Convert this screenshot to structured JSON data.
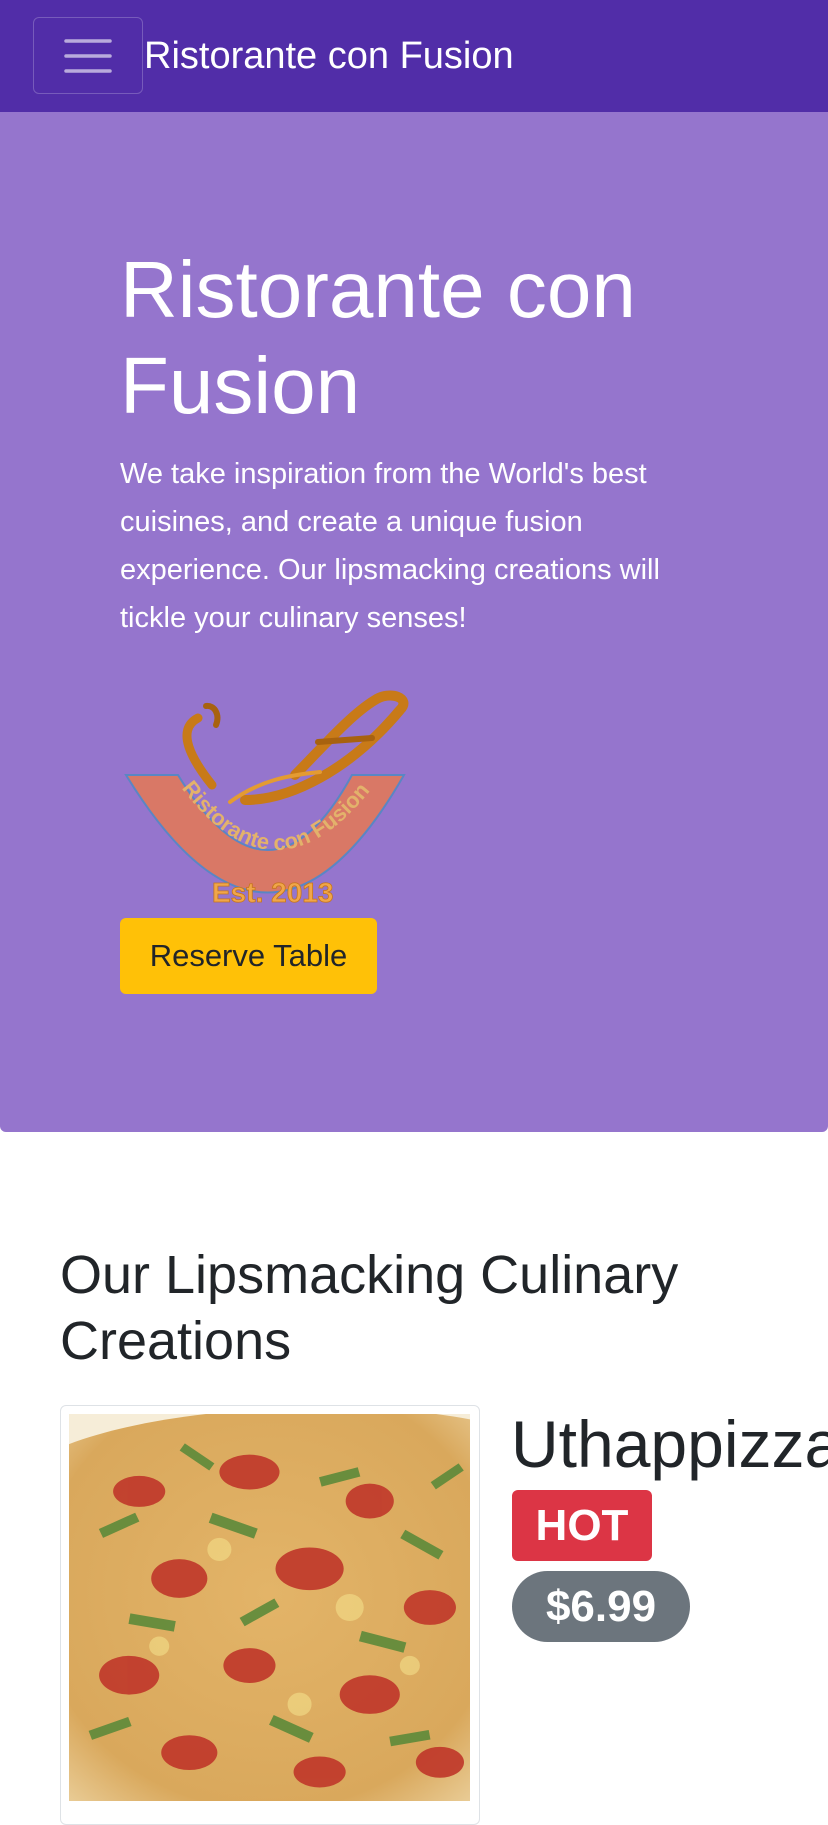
{
  "navbar": {
    "brand": "Ristorante con Fusion",
    "toggler_icon": "hamburger-menu-icon",
    "background_color": "#512da8"
  },
  "hero": {
    "title": "Ristorante con Fusion",
    "description": "We take inspiration from the World's best cuisines, and create a unique fusion experience. Our lipsmacking creations will tickle your culinary senses!",
    "logo": {
      "text": "Ristorante con Fusion",
      "established": "Est. 2013"
    },
    "reserve_button": "Reserve Table",
    "background_color": "#9575cd",
    "button_color": "#ffc107"
  },
  "menu_section": {
    "title": "Our Lipsmacking Culinary Creations",
    "dish": {
      "name": "Uthappizza",
      "badge": "HOT",
      "price": "$6.99",
      "badge_color": "#dc3545",
      "price_color": "#6c757d"
    }
  }
}
